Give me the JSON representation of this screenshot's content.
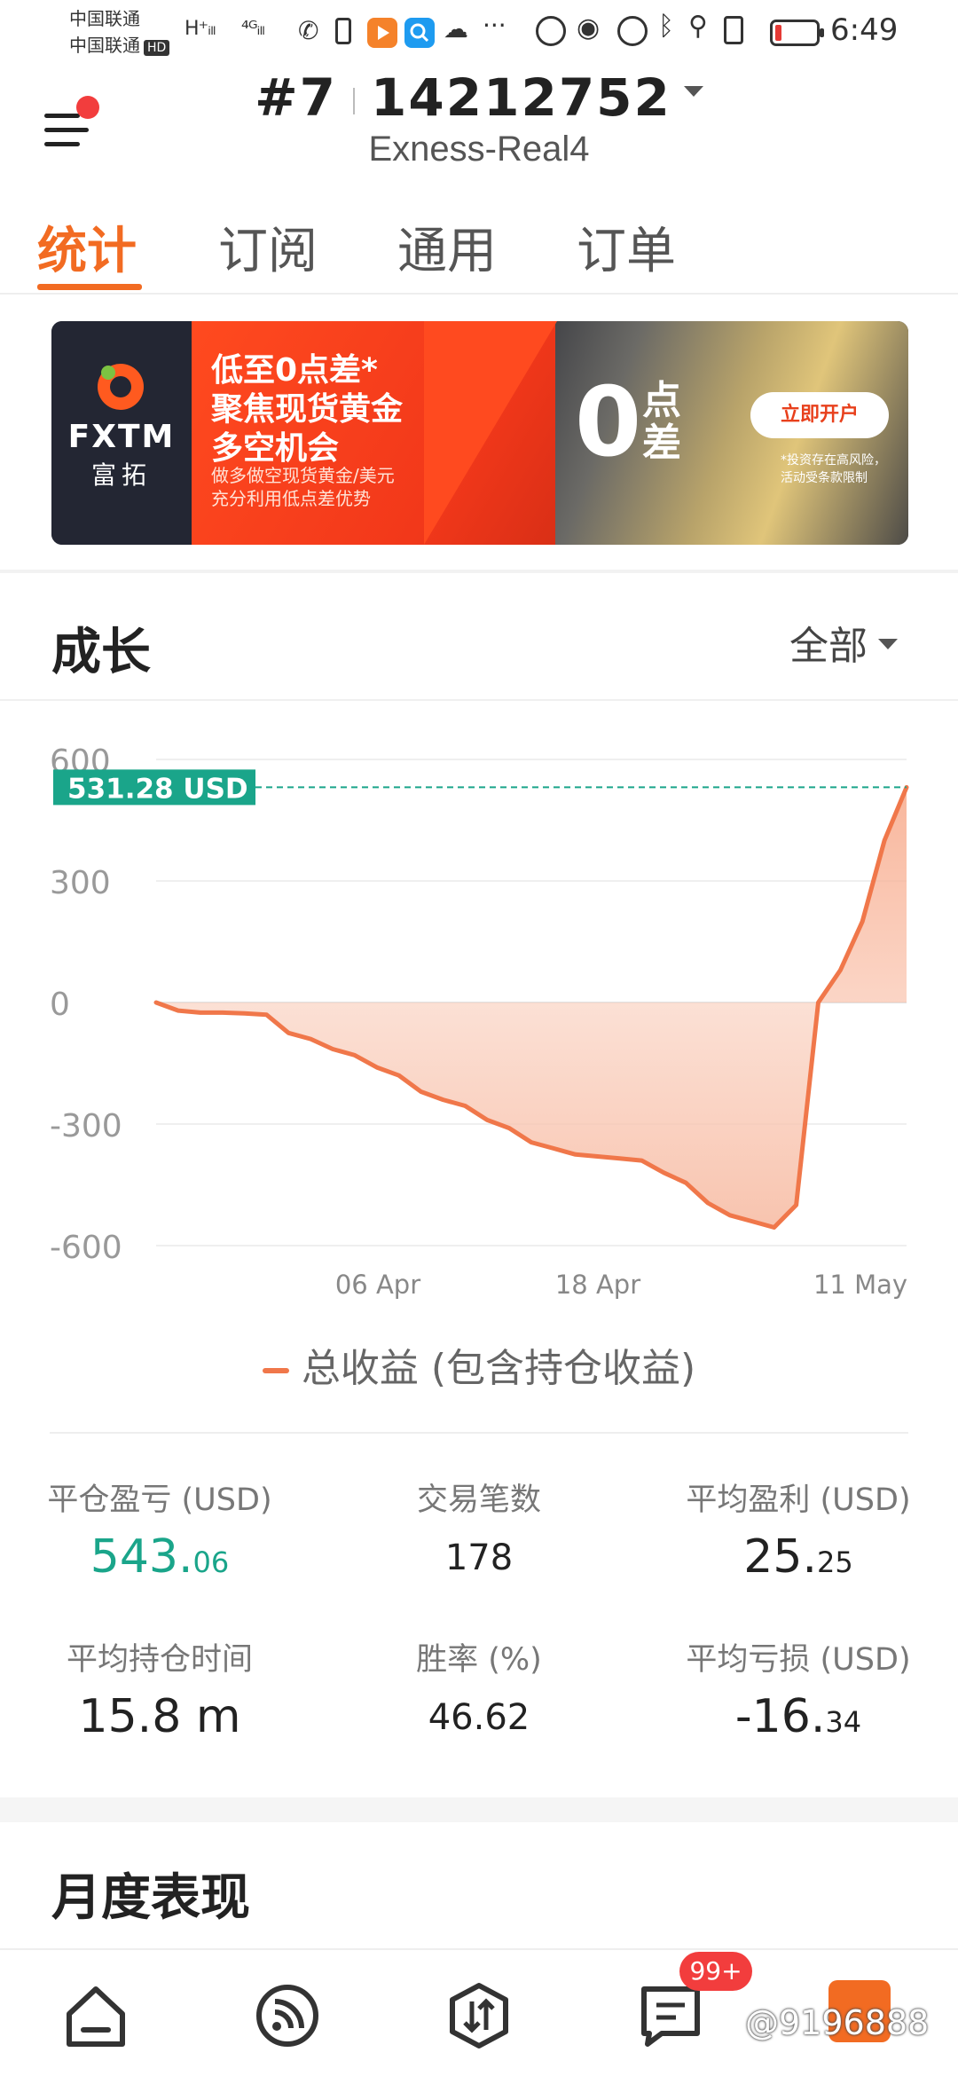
{
  "status_bar": {
    "carrier_1": "中国联通",
    "carrier_2": "中国联通",
    "carrier_2_badge": "HD",
    "signal_1": "H⁺ᵢₗₗ",
    "signal_2": "⁴ᴳᵢₗₗ",
    "time": "6:49",
    "icons": [
      "missed-call-icon",
      "phone-icon",
      "video-app-icon",
      "search-app-icon",
      "weather-icon",
      "more-icon",
      "nfc-icon",
      "eye-icon",
      "alarm-icon",
      "bluetooth-icon",
      "location-icon",
      "vibrate-icon",
      "battery-icon"
    ]
  },
  "header": {
    "account_prefix": "#7",
    "account_number": "14212752",
    "server": "Exness-Real4"
  },
  "tabs": [
    {
      "label": "统计",
      "active": true
    },
    {
      "label": "订阅",
      "active": false
    },
    {
      "label": "通用",
      "active": false
    },
    {
      "label": "订单",
      "active": false
    }
  ],
  "banner": {
    "brand": "FXTM",
    "brand_cn": "富拓",
    "line1": "低至0点差*",
    "line2": "聚焦现货黄金",
    "line3": "多空机会",
    "line4": "做多做空现货黄金/美元",
    "line5": "充分利用低点差优势",
    "zero": "0",
    "dian_cha": "点差",
    "cta": "立即开户",
    "risk1": "*投资存在高风险，",
    "risk2": "活动受条款限制"
  },
  "growth": {
    "title": "成长",
    "filter": "全部"
  },
  "chart_data": {
    "type": "area",
    "title": "",
    "xlabel": "",
    "ylabel": "",
    "ylim": [
      -600,
      600
    ],
    "yticks": [
      600,
      300,
      0,
      -300,
      -600
    ],
    "xticks": [
      "06 Apr",
      "18 Apr",
      "11 May"
    ],
    "current_label": "531.28 USD",
    "current_value": 531.28,
    "series": [
      {
        "name": "总收益 (包含持仓收益)",
        "color": "#f0774a",
        "values": [
          0,
          -20,
          -25,
          -25,
          -27,
          -30,
          -75,
          -90,
          -115,
          -130,
          -160,
          -180,
          -220,
          -240,
          -255,
          -290,
          -310,
          -345,
          -360,
          -375,
          -380,
          -385,
          -390,
          -420,
          -445,
          -495,
          -525,
          -540,
          -555,
          -500,
          0,
          80,
          200,
          400,
          531.28
        ]
      }
    ]
  },
  "legend_label": "总收益 (包含持仓收益)",
  "stats": {
    "closed_pl_label": "平仓盈亏 (USD)",
    "closed_pl_int": "543.",
    "closed_pl_dec": "06",
    "trades_label": "交易笔数",
    "trades_value": "178",
    "avg_profit_label": "平均盈利 (USD)",
    "avg_profit_int": "25.",
    "avg_profit_dec": "25",
    "avg_hold_label": "平均持仓时间",
    "avg_hold_value": "15.8 m",
    "win_rate_label": "胜率 (%)",
    "win_rate_value": "46.62",
    "avg_loss_label": "平均亏损 (USD)",
    "avg_loss_int": "-16.",
    "avg_loss_dec": "34"
  },
  "monthly": {
    "title": "月度表现"
  },
  "bottom_nav": {
    "items": [
      "home-icon",
      "feed-icon",
      "trade-icon",
      "messages-icon",
      "profile-icon"
    ],
    "badge": "99+",
    "watermark": "@9196888"
  },
  "colors": {
    "accent": "#f26b22",
    "green": "#1aa58a",
    "line": "#f0774a",
    "badge": "#f23d3d"
  }
}
